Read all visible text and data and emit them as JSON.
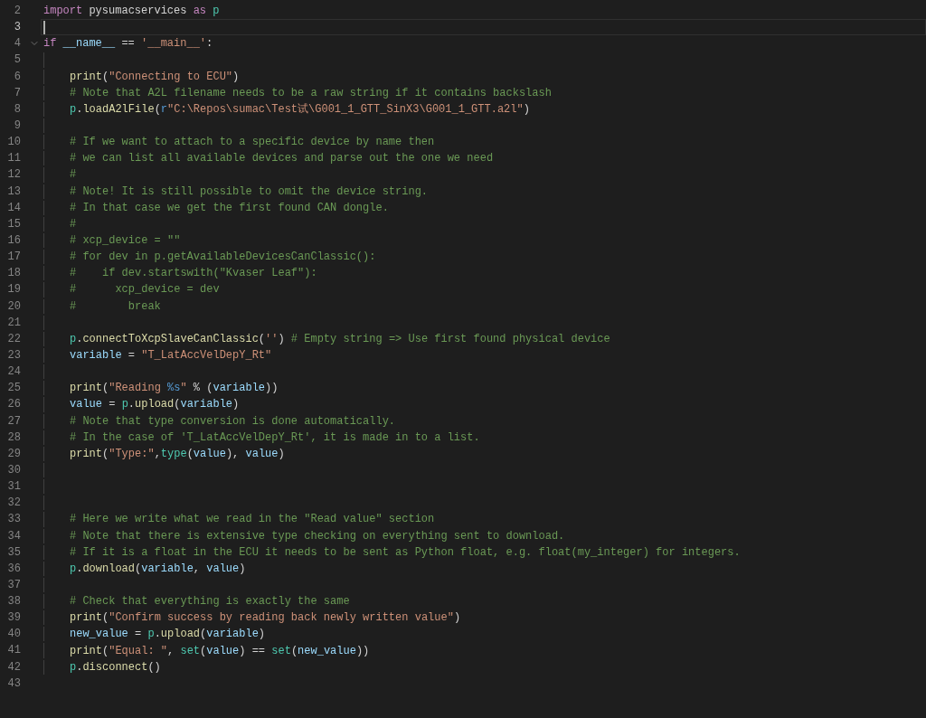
{
  "lines": [
    {
      "number": "2",
      "current": false,
      "tokens": [
        {
          "kind": "keyword",
          "text": "import"
        },
        {
          "kind": "plain",
          "text": " pysumacservices "
        },
        {
          "kind": "keyword",
          "text": "as"
        },
        {
          "kind": "class",
          "text": " p"
        }
      ]
    },
    {
      "number": "3",
      "current": true
    },
    {
      "number": "4",
      "current": false,
      "expanded": true,
      "tokens": [
        {
          "kind": "keyword",
          "text": "if"
        },
        {
          "kind": "variable",
          "text": " __name__"
        },
        {
          "kind": "plain",
          "text": " == "
        },
        {
          "kind": "string",
          "text": "'__main__'"
        },
        {
          "kind": "plain",
          "text": ":"
        }
      ],
      "children": [
        {
          "number": "5",
          "current": false
        },
        {
          "number": "6",
          "current": false,
          "tokens": [
            {
              "kind": "function",
              "text": "print"
            },
            {
              "kind": "plain",
              "text": "("
            },
            {
              "kind": "string",
              "text": "\"Connecting to ECU\""
            },
            {
              "kind": "plain",
              "text": ")"
            }
          ]
        },
        {
          "number": "7",
          "current": false,
          "tokens": [
            {
              "kind": "comment",
              "text": "# Note that A2L filename needs to be a raw string if it contains backslash"
            }
          ]
        },
        {
          "number": "8",
          "current": false,
          "tokens": [
            {
              "kind": "class",
              "text": "p"
            },
            {
              "kind": "plain",
              "text": "."
            },
            {
              "kind": "function",
              "text": "loadA2lFile"
            },
            {
              "kind": "plain",
              "text": "("
            },
            {
              "kind": "storage",
              "text": "r"
            },
            {
              "kind": "string",
              "text": "\"C:\\Repos\\sumac\\Test试\\G001_1_GTT_SinX3\\G001_1_GTT.a2l\""
            },
            {
              "kind": "plain",
              "text": ")"
            }
          ]
        },
        {
          "number": "9",
          "current": false
        },
        {
          "number": "10",
          "current": false,
          "tokens": [
            {
              "kind": "comment",
              "text": "# If we want to attach to a specific device by name then"
            }
          ]
        },
        {
          "number": "11",
          "current": false,
          "tokens": [
            {
              "kind": "comment",
              "text": "# we can list all available devices and parse out the one we need"
            }
          ]
        },
        {
          "number": "12",
          "current": false,
          "tokens": [
            {
              "kind": "comment",
              "text": "#"
            }
          ]
        },
        {
          "number": "13",
          "current": false,
          "tokens": [
            {
              "kind": "comment",
              "text": "# Note! It is still possible to omit the device string."
            }
          ]
        },
        {
          "number": "14",
          "current": false,
          "tokens": [
            {
              "kind": "comment",
              "text": "# In that case we get the first found CAN dongle."
            }
          ]
        },
        {
          "number": "15",
          "current": false,
          "tokens": [
            {
              "kind": "comment",
              "text": "#"
            }
          ]
        },
        {
          "number": "16",
          "current": false,
          "tokens": [
            {
              "kind": "comment",
              "text": "# xcp_device = \"\""
            }
          ]
        },
        {
          "number": "17",
          "current": false,
          "tokens": [
            {
              "kind": "comment",
              "text": "# for dev in p.getAvailableDevicesCanClassic():"
            }
          ]
        },
        {
          "number": "18",
          "current": false,
          "tokens": [
            {
              "kind": "comment",
              "text": "#    if dev.startswith(\"Kvaser Leaf\"):"
            }
          ]
        },
        {
          "number": "19",
          "current": false,
          "tokens": [
            {
              "kind": "comment",
              "text": "#      xcp_device = dev"
            }
          ]
        },
        {
          "number": "20",
          "current": false,
          "tokens": [
            {
              "kind": "comment",
              "text": "#        break"
            }
          ]
        },
        {
          "number": "21",
          "current": false
        },
        {
          "number": "22",
          "current": false,
          "tokens": [
            {
              "kind": "class",
              "text": "p"
            },
            {
              "kind": "plain",
              "text": "."
            },
            {
              "kind": "function",
              "text": "connectToXcpSlaveCanClassic"
            },
            {
              "kind": "plain",
              "text": "("
            },
            {
              "kind": "string",
              "text": "''"
            },
            {
              "kind": "plain",
              "text": ") "
            },
            {
              "kind": "comment",
              "text": "# Empty string => Use first found physical device"
            }
          ]
        },
        {
          "number": "23",
          "current": false,
          "tokens": [
            {
              "kind": "variable",
              "text": "variable"
            },
            {
              "kind": "plain",
              "text": " = "
            },
            {
              "kind": "string",
              "text": "\"T_LatAccVelDepY_Rt\""
            }
          ]
        },
        {
          "number": "24",
          "current": false
        },
        {
          "number": "25",
          "current": false,
          "tokens": [
            {
              "kind": "function",
              "text": "print"
            },
            {
              "kind": "plain",
              "text": "("
            },
            {
              "kind": "string",
              "text": "\"Reading "
            },
            {
              "kind": "storage",
              "text": "%s"
            },
            {
              "kind": "string",
              "text": "\""
            },
            {
              "kind": "plain",
              "text": " % ("
            },
            {
              "kind": "variable",
              "text": "variable"
            },
            {
              "kind": "plain",
              "text": "))"
            }
          ]
        },
        {
          "number": "26",
          "current": false,
          "tokens": [
            {
              "kind": "variable",
              "text": "value"
            },
            {
              "kind": "plain",
              "text": " = "
            },
            {
              "kind": "class",
              "text": "p"
            },
            {
              "kind": "plain",
              "text": "."
            },
            {
              "kind": "function",
              "text": "upload"
            },
            {
              "kind": "plain",
              "text": "("
            },
            {
              "kind": "variable",
              "text": "variable"
            },
            {
              "kind": "plain",
              "text": ")"
            }
          ]
        },
        {
          "number": "27",
          "current": false,
          "tokens": [
            {
              "kind": "comment",
              "text": "# Note that type conversion is done automatically."
            }
          ]
        },
        {
          "number": "28",
          "current": false,
          "tokens": [
            {
              "kind": "comment",
              "text": "# In the case of 'T_LatAccVelDepY_Rt', it is made in to a list."
            }
          ]
        },
        {
          "number": "29",
          "current": false,
          "tokens": [
            {
              "kind": "function",
              "text": "print"
            },
            {
              "kind": "plain",
              "text": "("
            },
            {
              "kind": "string",
              "text": "\"Type:\""
            },
            {
              "kind": "plain",
              "text": ","
            },
            {
              "kind": "class",
              "text": "type"
            },
            {
              "kind": "plain",
              "text": "("
            },
            {
              "kind": "variable",
              "text": "value"
            },
            {
              "kind": "plain",
              "text": "), "
            },
            {
              "kind": "variable",
              "text": "value"
            },
            {
              "kind": "plain",
              "text": ")"
            }
          ]
        },
        {
          "number": "30",
          "current": false
        },
        {
          "number": "31",
          "current": false
        },
        {
          "number": "32",
          "current": false
        },
        {
          "number": "33",
          "current": false,
          "tokens": [
            {
              "kind": "comment",
              "text": "# Here we write what we read in the \"Read value\" section"
            }
          ]
        },
        {
          "number": "34",
          "current": false,
          "tokens": [
            {
              "kind": "comment",
              "text": "# Note that there is extensive type checking on everything sent to download."
            }
          ]
        },
        {
          "number": "35",
          "current": false,
          "tokens": [
            {
              "kind": "comment",
              "text": "# If it is a float in the ECU it needs to be sent as Python float, e.g. float(my_integer) for integers."
            }
          ]
        },
        {
          "number": "36",
          "current": false,
          "tokens": [
            {
              "kind": "class",
              "text": "p"
            },
            {
              "kind": "plain",
              "text": "."
            },
            {
              "kind": "function",
              "text": "download"
            },
            {
              "kind": "plain",
              "text": "("
            },
            {
              "kind": "variable",
              "text": "variable"
            },
            {
              "kind": "plain",
              "text": ", "
            },
            {
              "kind": "variable",
              "text": "value"
            },
            {
              "kind": "plain",
              "text": ")"
            }
          ]
        },
        {
          "number": "37",
          "current": false
        },
        {
          "number": "38",
          "current": false,
          "tokens": [
            {
              "kind": "comment",
              "text": "# Check that everything is exactly the same"
            }
          ]
        },
        {
          "number": "39",
          "current": false,
          "tokens": [
            {
              "kind": "function",
              "text": "print"
            },
            {
              "kind": "plain",
              "text": "("
            },
            {
              "kind": "string",
              "text": "\"Confirm success by reading back newly written value\""
            },
            {
              "kind": "plain",
              "text": ")"
            }
          ]
        },
        {
          "number": "40",
          "current": false,
          "tokens": [
            {
              "kind": "variable",
              "text": "new_value"
            },
            {
              "kind": "plain",
              "text": " = "
            },
            {
              "kind": "class",
              "text": "p"
            },
            {
              "kind": "plain",
              "text": "."
            },
            {
              "kind": "function",
              "text": "upload"
            },
            {
              "kind": "plain",
              "text": "("
            },
            {
              "kind": "variable",
              "text": "variable"
            },
            {
              "kind": "plain",
              "text": ")"
            }
          ]
        },
        {
          "number": "41",
          "current": false,
          "tokens": [
            {
              "kind": "function",
              "text": "print"
            },
            {
              "kind": "plain",
              "text": "("
            },
            {
              "kind": "string",
              "text": "\"Equal: \""
            },
            {
              "kind": "plain",
              "text": ", "
            },
            {
              "kind": "class",
              "text": "set"
            },
            {
              "kind": "plain",
              "text": "("
            },
            {
              "kind": "variable",
              "text": "value"
            },
            {
              "kind": "plain",
              "text": ") == "
            },
            {
              "kind": "class",
              "text": "set"
            },
            {
              "kind": "plain",
              "text": "("
            },
            {
              "kind": "variable",
              "text": "new_value"
            },
            {
              "kind": "plain",
              "text": "))"
            }
          ]
        },
        {
          "number": "42",
          "current": false,
          "tokens": [
            {
              "kind": "class",
              "text": "p"
            },
            {
              "kind": "plain",
              "text": "."
            },
            {
              "kind": "function",
              "text": "disconnect"
            },
            {
              "kind": "plain",
              "text": "()"
            }
          ]
        }
      ]
    },
    {
      "number": "43",
      "current": false
    }
  ]
}
